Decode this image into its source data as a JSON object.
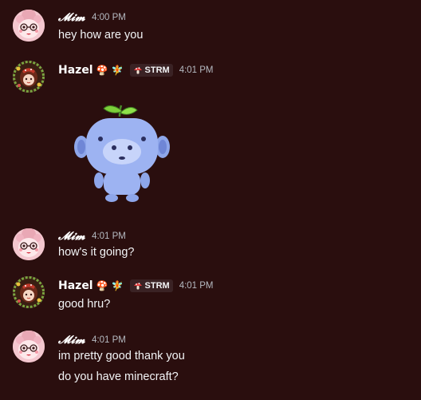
{
  "messages": [
    {
      "author": "𝓜𝓲𝓶",
      "time": "4:00 PM",
      "lines": [
        "hey how are you"
      ]
    },
    {
      "author": "Hazel",
      "emojis": [
        "🍄",
        "🧚"
      ],
      "tag": "STRM",
      "tag_icon": "mushroom-icon",
      "time": "4:01 PM",
      "sticker": "wumpus-sprout-sticker"
    },
    {
      "author": "𝓜𝓲𝓶",
      "time": "4:01 PM",
      "lines": [
        "how's it going?"
      ]
    },
    {
      "author": "Hazel",
      "emojis": [
        "🍄",
        "🧚"
      ],
      "tag": "STRM",
      "tag_icon": "mushroom-icon",
      "time": "4:01 PM",
      "lines": [
        "good hru?"
      ]
    },
    {
      "author": "𝓜𝓲𝓶",
      "time": "4:01 PM",
      "lines": [
        "im pretty good thank you",
        "do you have minecraft?"
      ]
    }
  ],
  "colors": {
    "background": "#2a0e0e",
    "text": "#f2f3f5",
    "timestamp": "#b5bac1",
    "tag_bg": "#3a2224"
  }
}
